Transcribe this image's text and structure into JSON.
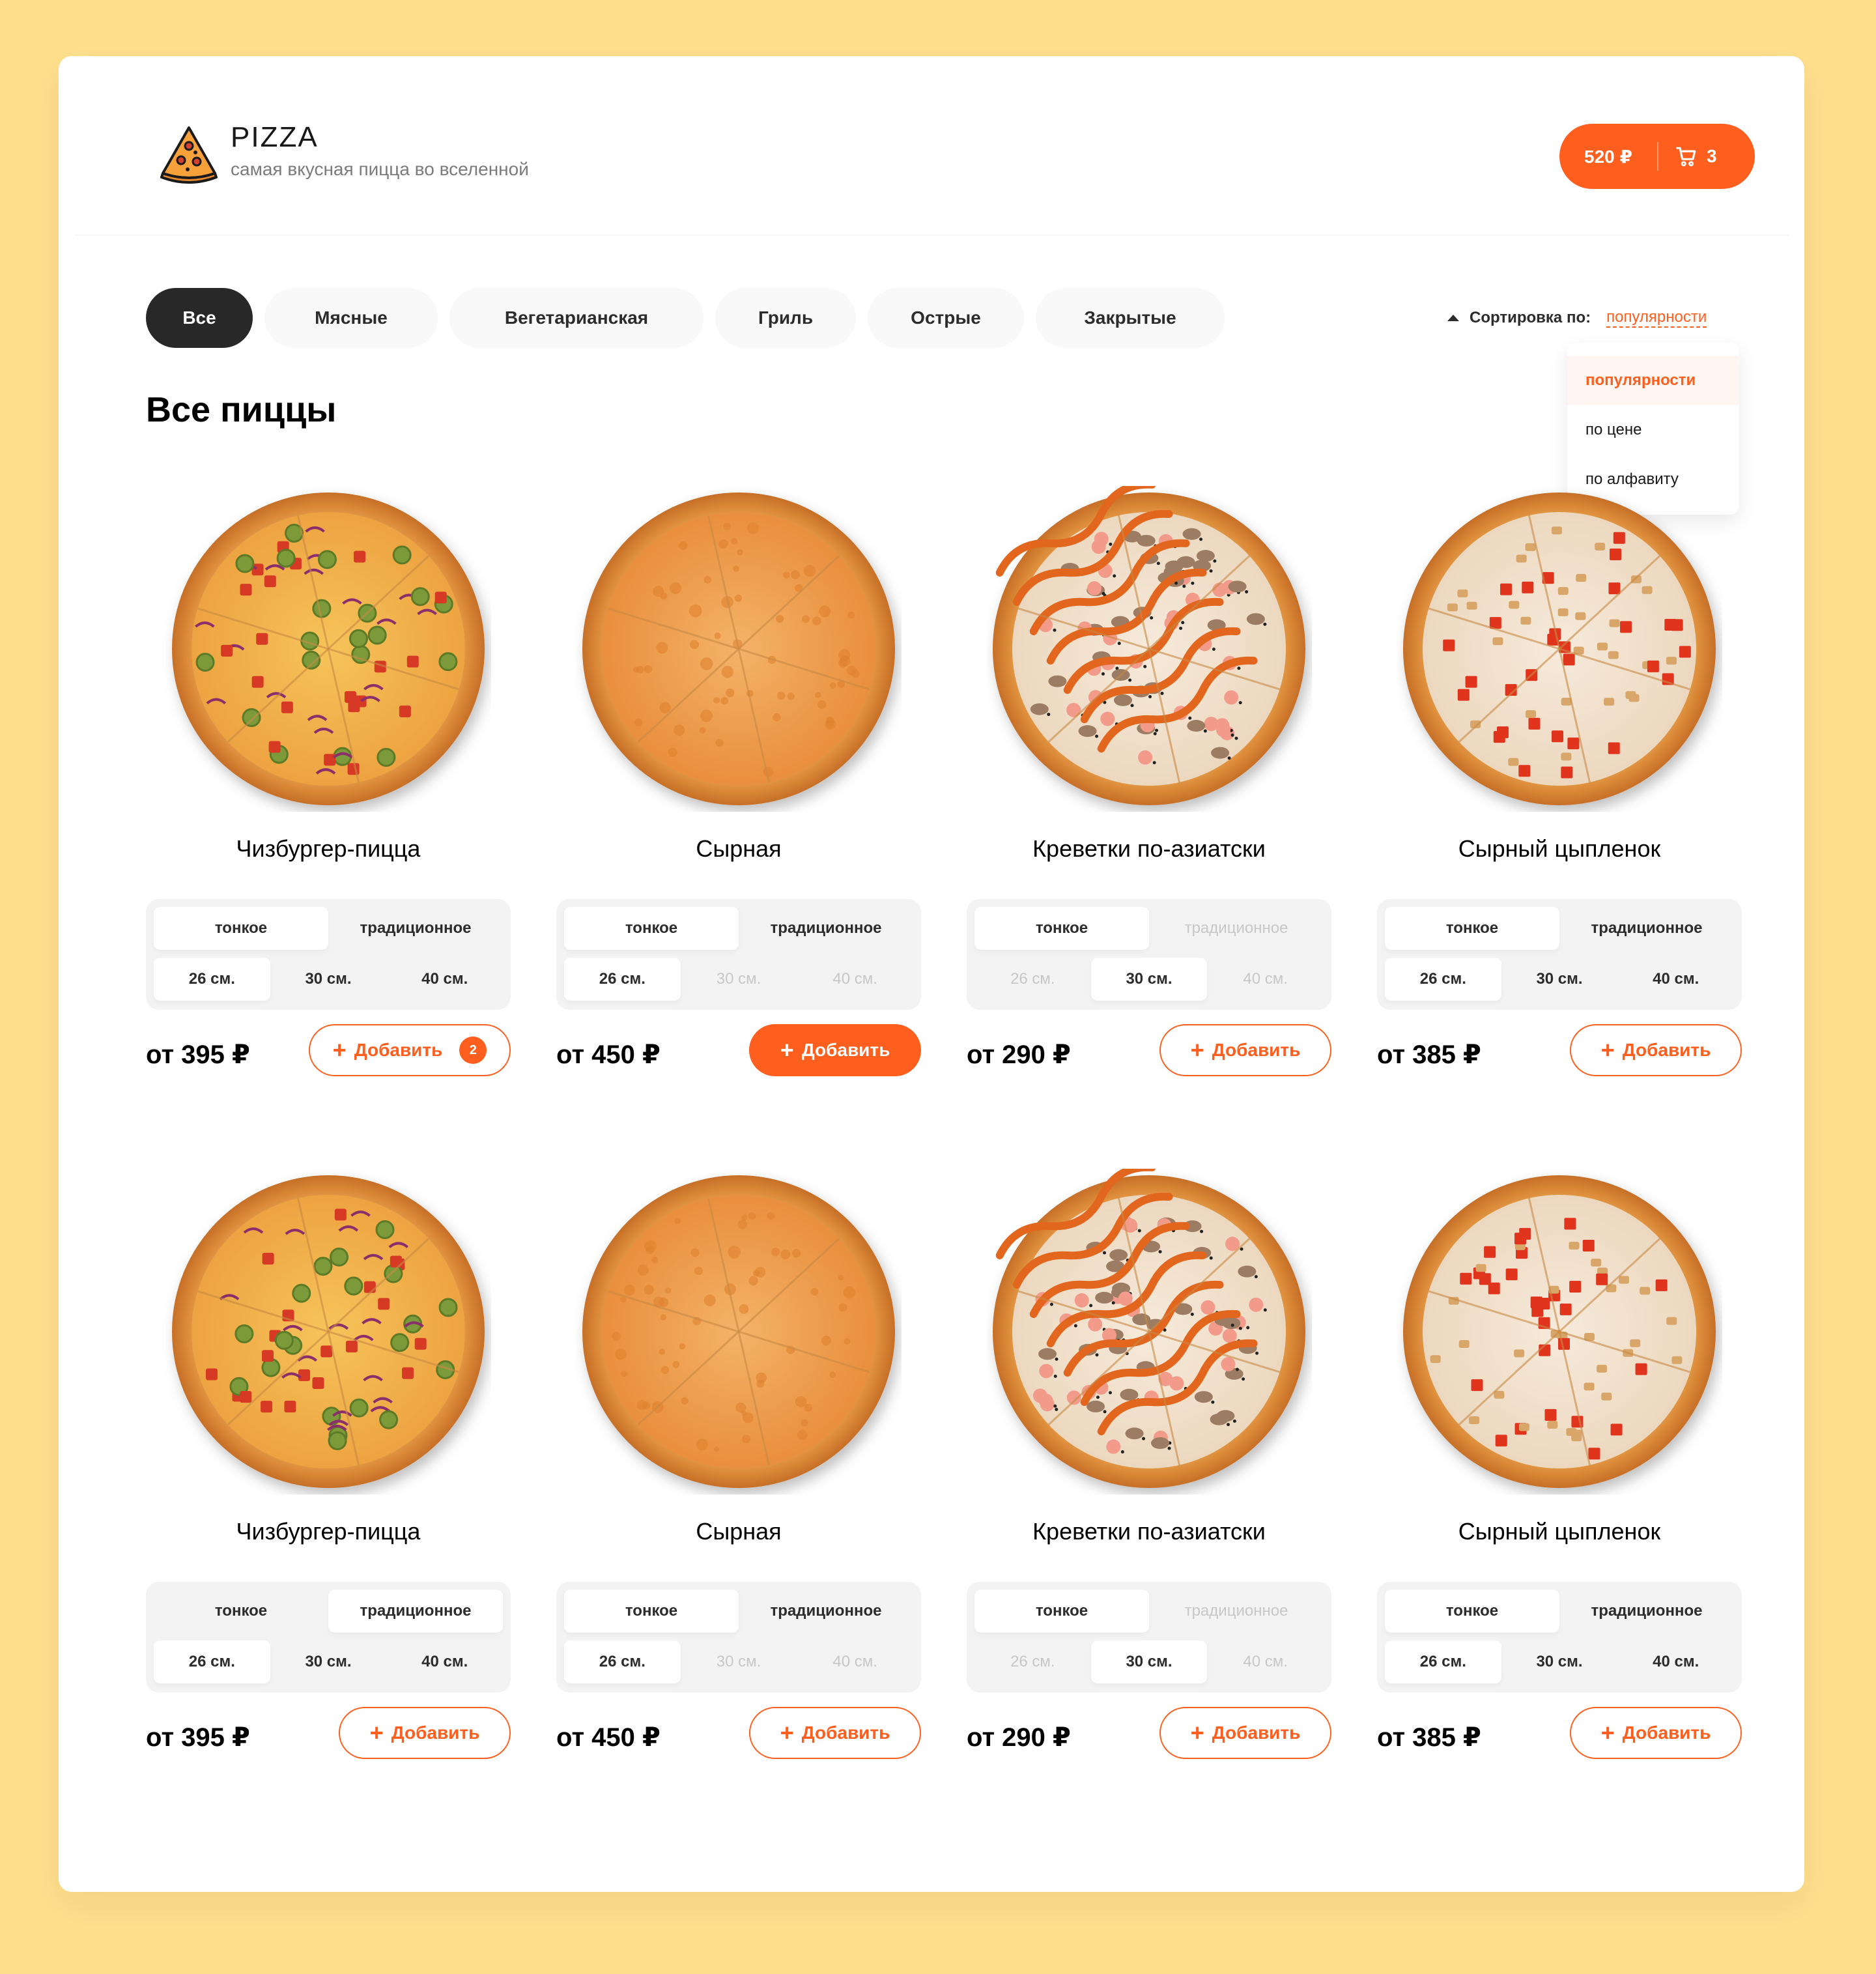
{
  "header": {
    "title": "PIZZA",
    "subtitle": "самая вкусная пицца во вселенной",
    "cart_total": "520 ₽",
    "cart_count": "3"
  },
  "categories": [
    "Все",
    "Мясные",
    "Вегетарианская",
    "Гриль",
    "Острые",
    "Закрытые"
  ],
  "active_category": "Все",
  "sort": {
    "label": "Сортировка по:",
    "value": "популярности",
    "options": [
      "популярности",
      "по цене",
      "по алфавиту"
    ]
  },
  "section_title": "Все пиццы",
  "cards": [
    {
      "name": "Чизбургер-пицца",
      "types": [
        "тонкое",
        "традиционное"
      ],
      "sizes": [
        "26 см.",
        "30 см.",
        "40 см."
      ],
      "price": "от 395 ₽",
      "add_label": "Добавить",
      "added_count": "2"
    },
    {
      "name": "Сырная",
      "types": [
        "тонкое",
        "традиционное"
      ],
      "sizes": [
        "26 см.",
        "30 см.",
        "40 см."
      ],
      "price": "от 450 ₽",
      "add_label": "Добавить",
      "added_count": ""
    },
    {
      "name": "Креветки по-азиатски",
      "types": [
        "тонкое",
        "традиционное"
      ],
      "sizes": [
        "26 см.",
        "30 см.",
        "40 см."
      ],
      "price": "от 290 ₽",
      "add_label": "Добавить",
      "added_count": ""
    },
    {
      "name": "Сырный цыпленок",
      "types": [
        "тонкое",
        "традиционное"
      ],
      "sizes": [
        "26 см.",
        "30 см.",
        "40 см."
      ],
      "price": "от 385 ₽",
      "add_label": "Добавить",
      "added_count": ""
    },
    {
      "name": "Чизбургер-пицца",
      "types": [
        "тонкое",
        "традиционное"
      ],
      "sizes": [
        "26 см.",
        "30 см.",
        "40 см."
      ],
      "price": "от 395 ₽",
      "add_label": "Добавить",
      "added_count": ""
    },
    {
      "name": "Сырная",
      "types": [
        "тонкое",
        "традиционное"
      ],
      "sizes": [
        "26 см.",
        "30 см.",
        "40 см."
      ],
      "price": "от 450 ₽",
      "add_label": "Добавить",
      "added_count": ""
    },
    {
      "name": "Креветки по-азиатски",
      "types": [
        "тонкое",
        "традиционное"
      ],
      "sizes": [
        "26 см.",
        "30 см.",
        "40 см."
      ],
      "price": "от 290 ₽",
      "add_label": "Добавить",
      "added_count": ""
    },
    {
      "name": "Сырный цыпленок",
      "types": [
        "тонкое",
        "традиционное"
      ],
      "sizes": [
        "26 см.",
        "30 см.",
        "40 см."
      ],
      "price": "от 385 ₽",
      "add_label": "Добавить",
      "added_count": ""
    }
  ],
  "colors": {
    "accent": "#fe5f1e",
    "background": "#ffdf8c",
    "dark": "#282828"
  }
}
